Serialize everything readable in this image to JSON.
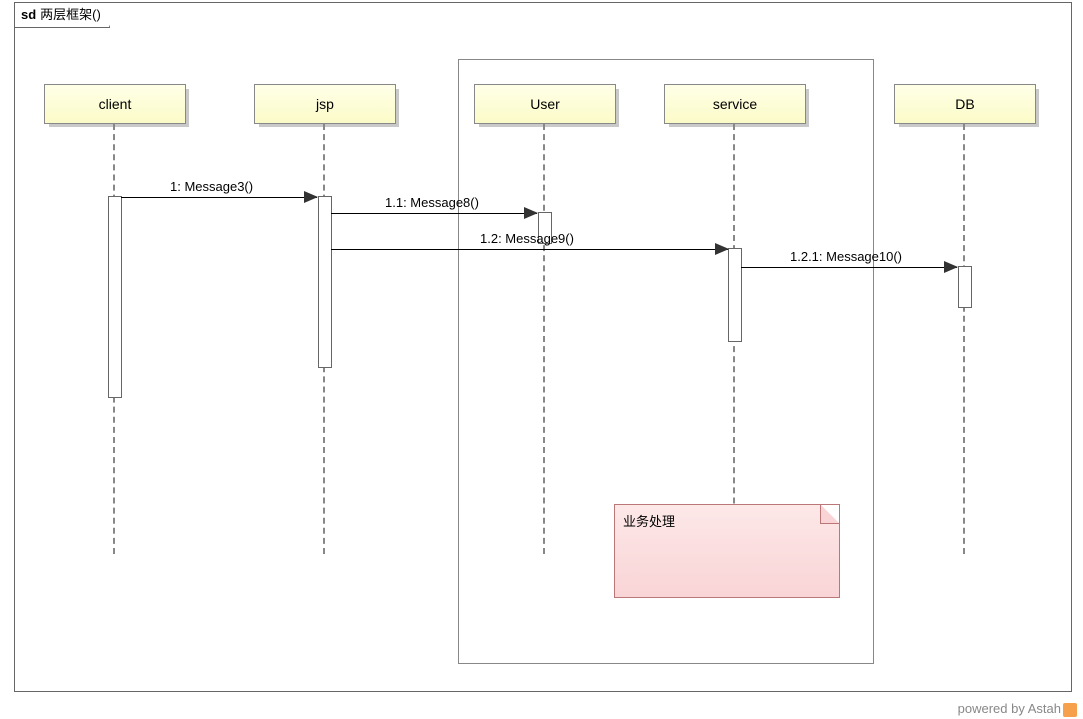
{
  "frame": {
    "prefix": "sd",
    "name": "两层框架()"
  },
  "lifelines": [
    {
      "name": "client"
    },
    {
      "name": "jsp"
    },
    {
      "name": "User"
    },
    {
      "name": "service"
    },
    {
      "name": "DB"
    }
  ],
  "messages": [
    {
      "label": "1: Message3()",
      "from": "client",
      "to": "jsp"
    },
    {
      "label": "1.1: Message8()",
      "from": "jsp",
      "to": "User"
    },
    {
      "label": "1.2: Message9()",
      "from": "jsp",
      "to": "service"
    },
    {
      "label": "1.2.1: Message10()",
      "from": "service",
      "to": "DB"
    }
  ],
  "note": {
    "text": "业务处理"
  },
  "footer": {
    "text": "powered by Astah"
  }
}
